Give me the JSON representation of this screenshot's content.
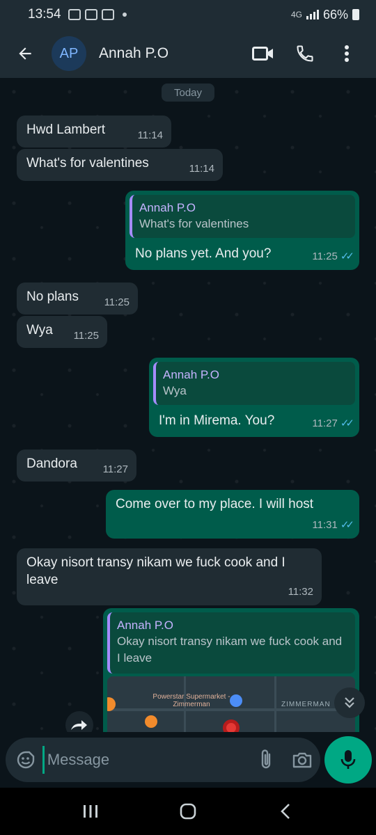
{
  "status_bar": {
    "time": "13:54",
    "network": "4G",
    "battery": "66%"
  },
  "header": {
    "avatar_initials": "AP",
    "contact_name": "Annah P.O"
  },
  "chat": {
    "date_chip": "Today",
    "messages": [
      {
        "direction": "in",
        "text": "Hwd Lambert",
        "time": "11:14"
      },
      {
        "direction": "in",
        "text": "What's for valentines",
        "time": "11:14"
      },
      {
        "direction": "out",
        "quote_name": "Annah P.O",
        "quote_text": "What's for valentines",
        "text": "No plans yet. And you?",
        "time": "11:25",
        "read": true
      },
      {
        "direction": "in",
        "text": "No plans",
        "time": "11:25"
      },
      {
        "direction": "in",
        "text": "Wya",
        "time": "11:25"
      },
      {
        "direction": "out",
        "quote_name": "Annah P.O",
        "quote_text": "Wya",
        "text": "I'm in Mirema. You?",
        "time": "11:27",
        "read": true
      },
      {
        "direction": "in",
        "text": "Dandora",
        "time": "11:27"
      },
      {
        "direction": "out",
        "text": "Come over to my place. I will host",
        "time": "11:31",
        "read": true
      },
      {
        "direction": "in",
        "text": "Okay nisort transy nikam we fuck cook and I leave",
        "time": "11:32"
      },
      {
        "direction": "out",
        "quote_name": "Annah P.O",
        "quote_text": "Okay nisort transy nikam we fuck cook and I leave",
        "map_place": "Powerstar Supermarket - Zimmerman",
        "map_area": "ZIMMERMAN"
      }
    ]
  },
  "composer": {
    "placeholder": "Message"
  },
  "icons": {
    "back": "arrow-left-icon",
    "video": "video-call-icon",
    "call": "phone-icon",
    "menu": "more-vert-icon",
    "emoji": "emoji-icon",
    "attach": "paperclip-icon",
    "camera": "camera-icon",
    "mic": "mic-icon",
    "forward": "forward-icon",
    "scroll_down": "double-chevron-down-icon"
  },
  "colors": {
    "header_bg": "#1f2c34",
    "chat_bg": "#0b141a",
    "incoming_bubble": "#202c33",
    "outgoing_bubble": "#005c4b",
    "accent": "#00a884",
    "read_ticks": "#53bdeb",
    "quote_bar": "#a58cff"
  }
}
